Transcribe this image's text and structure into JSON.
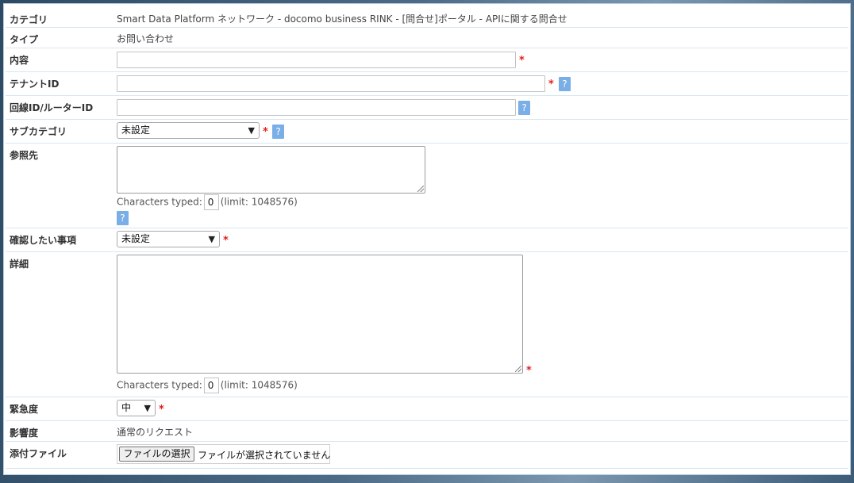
{
  "rows": {
    "category": {
      "label": "カテゴリ",
      "value": "Smart Data Platform ネットワーク - docomo business RINK - [問合せ]ポータル - APIに関する問合せ"
    },
    "type": {
      "label": "タイプ",
      "value": "お問い合わせ"
    },
    "content": {
      "label": "内容",
      "value": "",
      "required": "*"
    },
    "tenant_id": {
      "label": "テナントID",
      "value": "",
      "required": "*",
      "help": "?"
    },
    "line_router_id": {
      "label": "回線ID/ルーターID",
      "value": "",
      "help": "?"
    },
    "subcategory": {
      "label": "サブカテゴリ",
      "selected": "未設定",
      "required": "*",
      "help": "?"
    },
    "reference": {
      "label": "参照先",
      "value": "",
      "counter_prefix": "Characters typed:",
      "counter_value": "0",
      "counter_suffix": "(limit: 1048576)",
      "help": "?"
    },
    "confirm_item": {
      "label": "確認したい事項",
      "selected": "未設定",
      "required": "*"
    },
    "detail": {
      "label": "詳細",
      "value": "",
      "required": "*",
      "counter_prefix": "Characters typed:",
      "counter_value": "0",
      "counter_suffix": "(limit: 1048576)"
    },
    "urgency": {
      "label": "緊急度",
      "selected": "中",
      "required": "*"
    },
    "impact": {
      "label": "影響度",
      "value": "通常のリクエスト"
    },
    "attachment": {
      "label": "添付ファイル",
      "button": "ファイルの選択",
      "status": "ファイルが選択されていません"
    }
  },
  "colors": {
    "required": "#e02020",
    "help_bg": "#79aee6",
    "row_border": "#d6e6f1",
    "panel_border": "#b9cde0"
  },
  "icons": {
    "dropdown": "chevron-down-icon",
    "resize": "resize-grip-icon"
  }
}
